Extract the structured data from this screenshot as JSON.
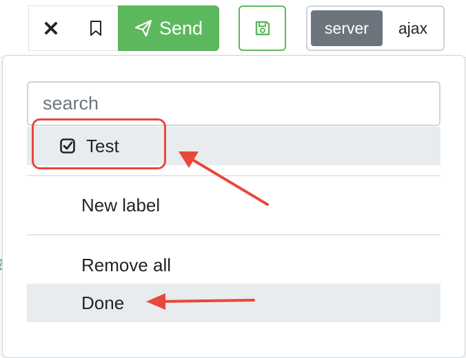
{
  "toolbar": {
    "close_icon": "close-icon",
    "bookmark_icon": "bookmark-icon",
    "send_label": "Send",
    "send_icon": "paper-plane-icon",
    "save_icon": "floppy-disk-icon",
    "mode_options": [
      {
        "label": "server",
        "active": true
      },
      {
        "label": "ajax",
        "active": false
      }
    ]
  },
  "stray_glyph": "ℓ",
  "dropdown": {
    "search": {
      "placeholder": "search",
      "value": ""
    },
    "items": [
      {
        "label": "Test",
        "checked": true,
        "highlighted": true
      },
      {
        "label": "New label"
      },
      {
        "label": "Remove all"
      },
      {
        "label": "Done",
        "highlighted": true
      }
    ]
  },
  "colors": {
    "send_green": "#5cb85c",
    "server_active": "#6c757d",
    "annotation_red": "#e8483a",
    "row_highlight": "#e9ecef"
  }
}
